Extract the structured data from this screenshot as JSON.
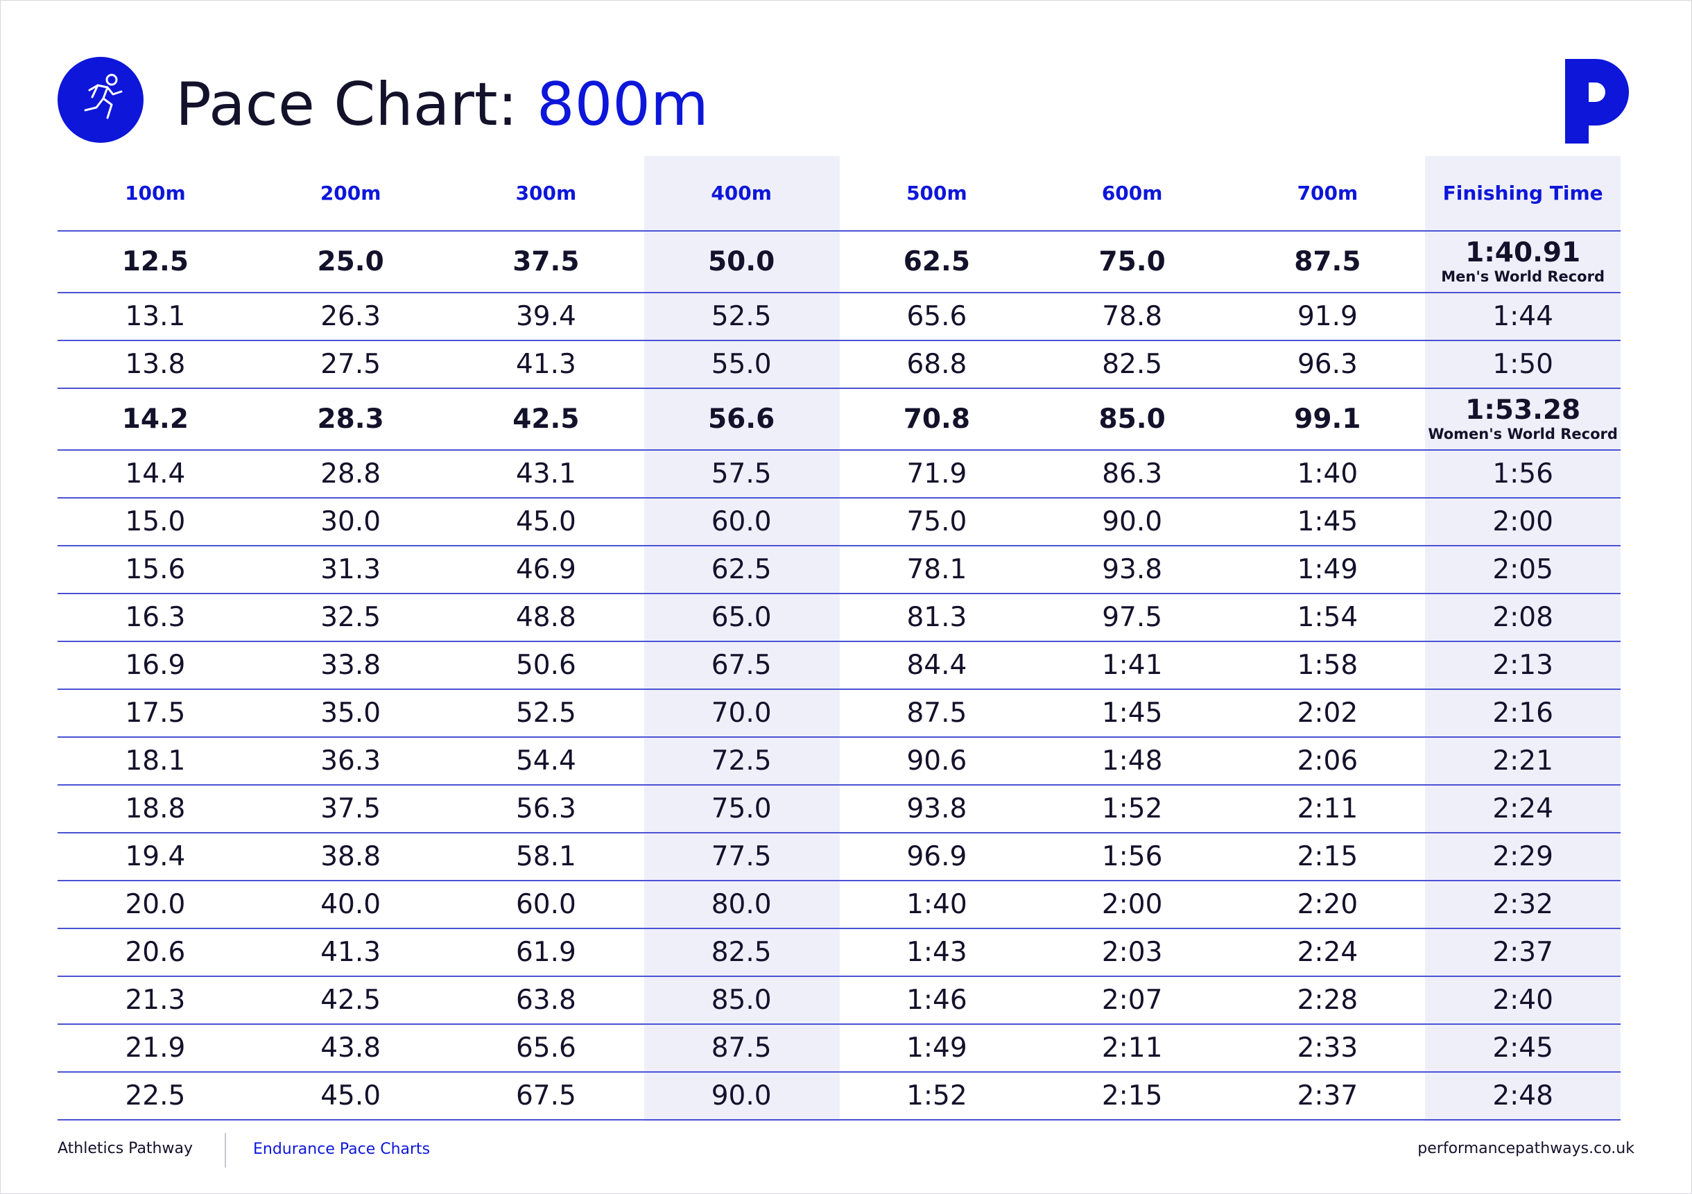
{
  "header": {
    "title_prefix": "Pace Chart: ",
    "title_accent": "800m"
  },
  "colors": {
    "accent": "#0d16d9",
    "text": "#14112b",
    "highlight": "#efeffa"
  },
  "table": {
    "columns": [
      "100m",
      "200m",
      "300m",
      "400m",
      "500m",
      "600m",
      "700m",
      "Finishing Time"
    ],
    "rows": [
      {
        "record": true,
        "cells": [
          "12.5",
          "25.0",
          "37.5",
          "50.0",
          "62.5",
          "75.0",
          "87.5",
          "1:40.91"
        ],
        "note": "Men's World Record"
      },
      {
        "cells": [
          "13.1",
          "26.3",
          "39.4",
          "52.5",
          "65.6",
          "78.8",
          "91.9",
          "1:44"
        ]
      },
      {
        "cells": [
          "13.8",
          "27.5",
          "41.3",
          "55.0",
          "68.8",
          "82.5",
          "96.3",
          "1:50"
        ]
      },
      {
        "record": true,
        "cells": [
          "14.2",
          "28.3",
          "42.5",
          "56.6",
          "70.8",
          "85.0",
          "99.1",
          "1:53.28"
        ],
        "note": "Women's World Record"
      },
      {
        "cells": [
          "14.4",
          "28.8",
          "43.1",
          "57.5",
          "71.9",
          "86.3",
          "1:40",
          "1:56"
        ]
      },
      {
        "cells": [
          "15.0",
          "30.0",
          "45.0",
          "60.0",
          "75.0",
          "90.0",
          "1:45",
          "2:00"
        ]
      },
      {
        "cells": [
          "15.6",
          "31.3",
          "46.9",
          "62.5",
          "78.1",
          "93.8",
          "1:49",
          "2:05"
        ]
      },
      {
        "cells": [
          "16.3",
          "32.5",
          "48.8",
          "65.0",
          "81.3",
          "97.5",
          "1:54",
          "2:08"
        ]
      },
      {
        "cells": [
          "16.9",
          "33.8",
          "50.6",
          "67.5",
          "84.4",
          "1:41",
          "1:58",
          "2:13"
        ]
      },
      {
        "cells": [
          "17.5",
          "35.0",
          "52.5",
          "70.0",
          "87.5",
          "1:45",
          "2:02",
          "2:16"
        ]
      },
      {
        "cells": [
          "18.1",
          "36.3",
          "54.4",
          "72.5",
          "90.6",
          "1:48",
          "2:06",
          "2:21"
        ]
      },
      {
        "cells": [
          "18.8",
          "37.5",
          "56.3",
          "75.0",
          "93.8",
          "1:52",
          "2:11",
          "2:24"
        ]
      },
      {
        "cells": [
          "19.4",
          "38.8",
          "58.1",
          "77.5",
          "96.9",
          "1:56",
          "2:15",
          "2:29"
        ]
      },
      {
        "cells": [
          "20.0",
          "40.0",
          "60.0",
          "80.0",
          "1:40",
          "2:00",
          "2:20",
          "2:32"
        ]
      },
      {
        "cells": [
          "20.6",
          "41.3",
          "61.9",
          "82.5",
          "1:43",
          "2:03",
          "2:24",
          "2:37"
        ]
      },
      {
        "cells": [
          "21.3",
          "42.5",
          "63.8",
          "85.0",
          "1:46",
          "2:07",
          "2:28",
          "2:40"
        ]
      },
      {
        "cells": [
          "21.9",
          "43.8",
          "65.6",
          "87.5",
          "1:49",
          "2:11",
          "2:33",
          "2:45"
        ]
      },
      {
        "cells": [
          "22.5",
          "45.0",
          "67.5",
          "90.0",
          "1:52",
          "2:15",
          "2:37",
          "2:48"
        ]
      }
    ]
  },
  "footer": {
    "left": "Athletics Pathway",
    "middle": "Endurance Pace Charts",
    "right": "performancepathways.co.uk"
  },
  "icons": {
    "header": "runner-icon",
    "brand": "performance-pathways-logo"
  }
}
